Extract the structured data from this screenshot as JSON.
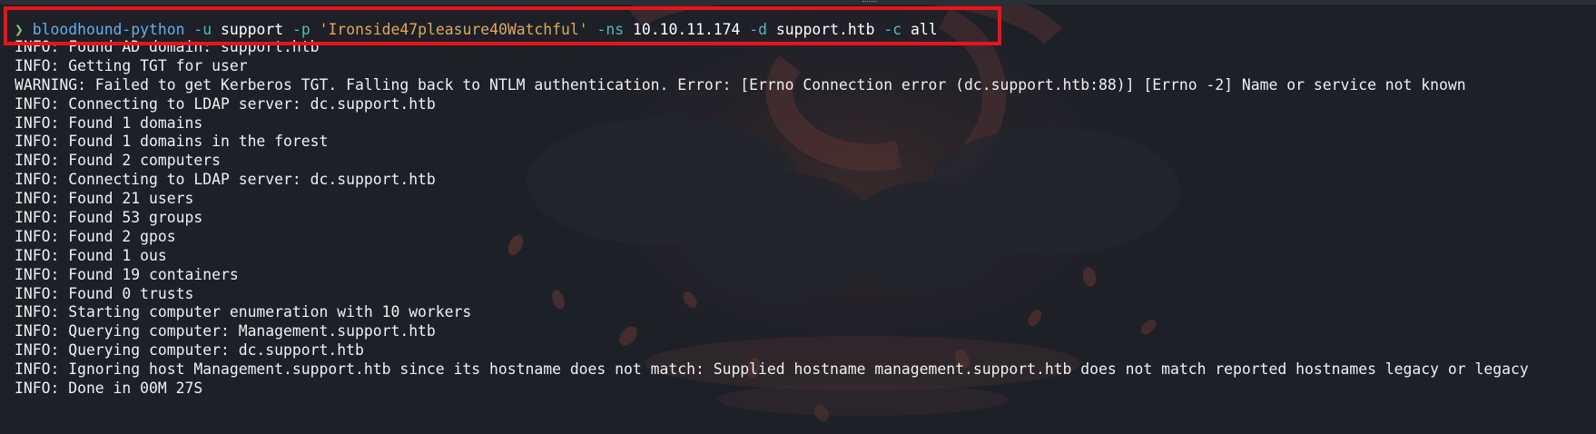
{
  "terminal": {
    "command": {
      "prompt": "❯",
      "program": "bloodhound-python",
      "flag_user": "-u",
      "user": "support",
      "flag_pass": "-p",
      "password": "'Ironside47pleasure40Watchful'",
      "flag_ns": "-ns",
      "nameserver": "10.10.11.174",
      "flag_domain": "-d",
      "domain": "support.htb",
      "flag_collect": "-c",
      "collect": "all"
    },
    "output": [
      "INFO: Found AD domain: support.htb",
      "INFO: Getting TGT for user",
      "WARNING: Failed to get Kerberos TGT. Falling back to NTLM authentication. Error: [Errno Connection error (dc.support.htb:88)] [Errno -2] Name or service not known",
      "INFO: Connecting to LDAP server: dc.support.htb",
      "INFO: Found 1 domains",
      "INFO: Found 1 domains in the forest",
      "INFO: Found 2 computers",
      "INFO: Connecting to LDAP server: dc.support.htb",
      "INFO: Found 21 users",
      "INFO: Found 53 groups",
      "INFO: Found 2 gpos",
      "INFO: Found 1 ous",
      "INFO: Found 19 containers",
      "INFO: Found 0 trusts",
      "INFO: Starting computer enumeration with 10 workers",
      "INFO: Querying computer: Management.support.htb",
      "INFO: Querying computer: dc.support.htb",
      "INFO: Ignoring host Management.support.htb since its hostname does not match: Supplied hostname management.support.htb does not match reported hostnames legacy or legacy",
      "INFO: Done in 00M 27S"
    ]
  },
  "colors": {
    "background": "#1d2027",
    "highlight_border": "#e8141b",
    "prompt": "#8ec07c",
    "command": "#61afef",
    "flag": "#56b6c2",
    "string": "#e5a55c"
  }
}
